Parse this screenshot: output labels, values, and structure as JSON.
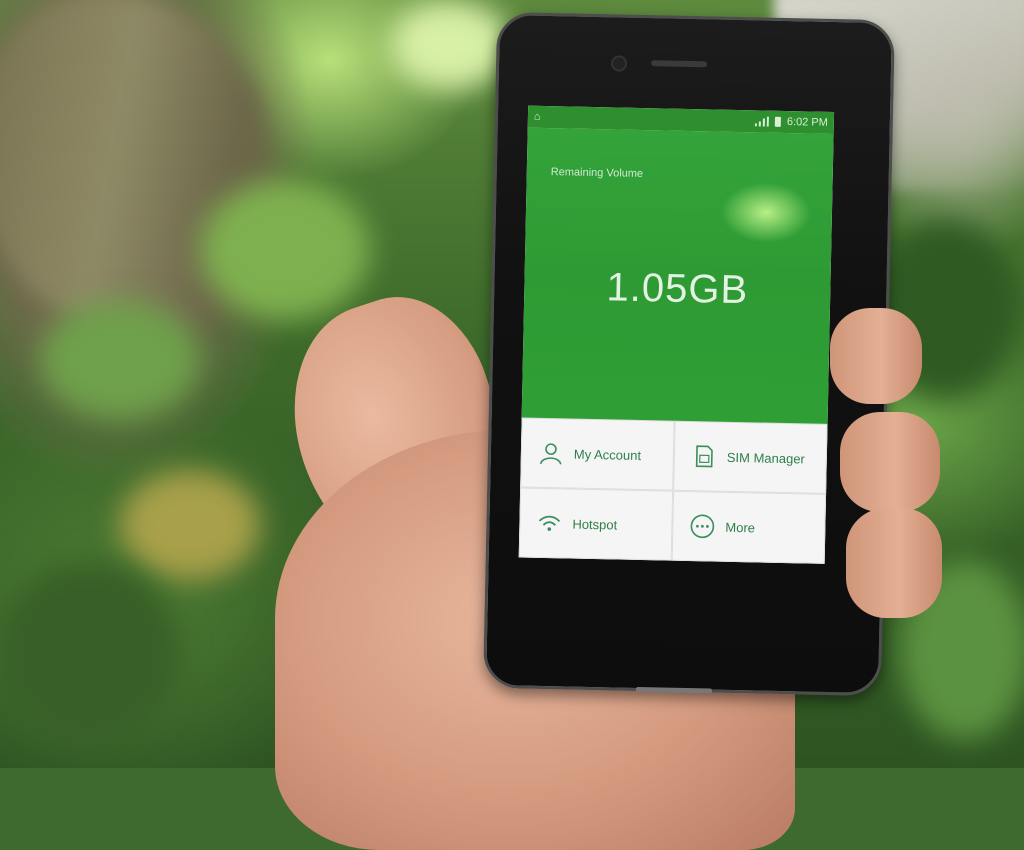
{
  "status_bar": {
    "time": "6:02 PM"
  },
  "hero": {
    "label": "Remaining Volume",
    "value": "1.05GB"
  },
  "menu": {
    "items": [
      {
        "label": "My Account",
        "icon": "person-icon"
      },
      {
        "label": "SIM Manager",
        "icon": "sim-card-icon"
      },
      {
        "label": "Hotspot",
        "icon": "wifi-icon"
      },
      {
        "label": "More",
        "icon": "more-dots-icon"
      }
    ]
  },
  "colors": {
    "accent_green": "#2e9a33",
    "menu_text": "#2f7f4a"
  }
}
